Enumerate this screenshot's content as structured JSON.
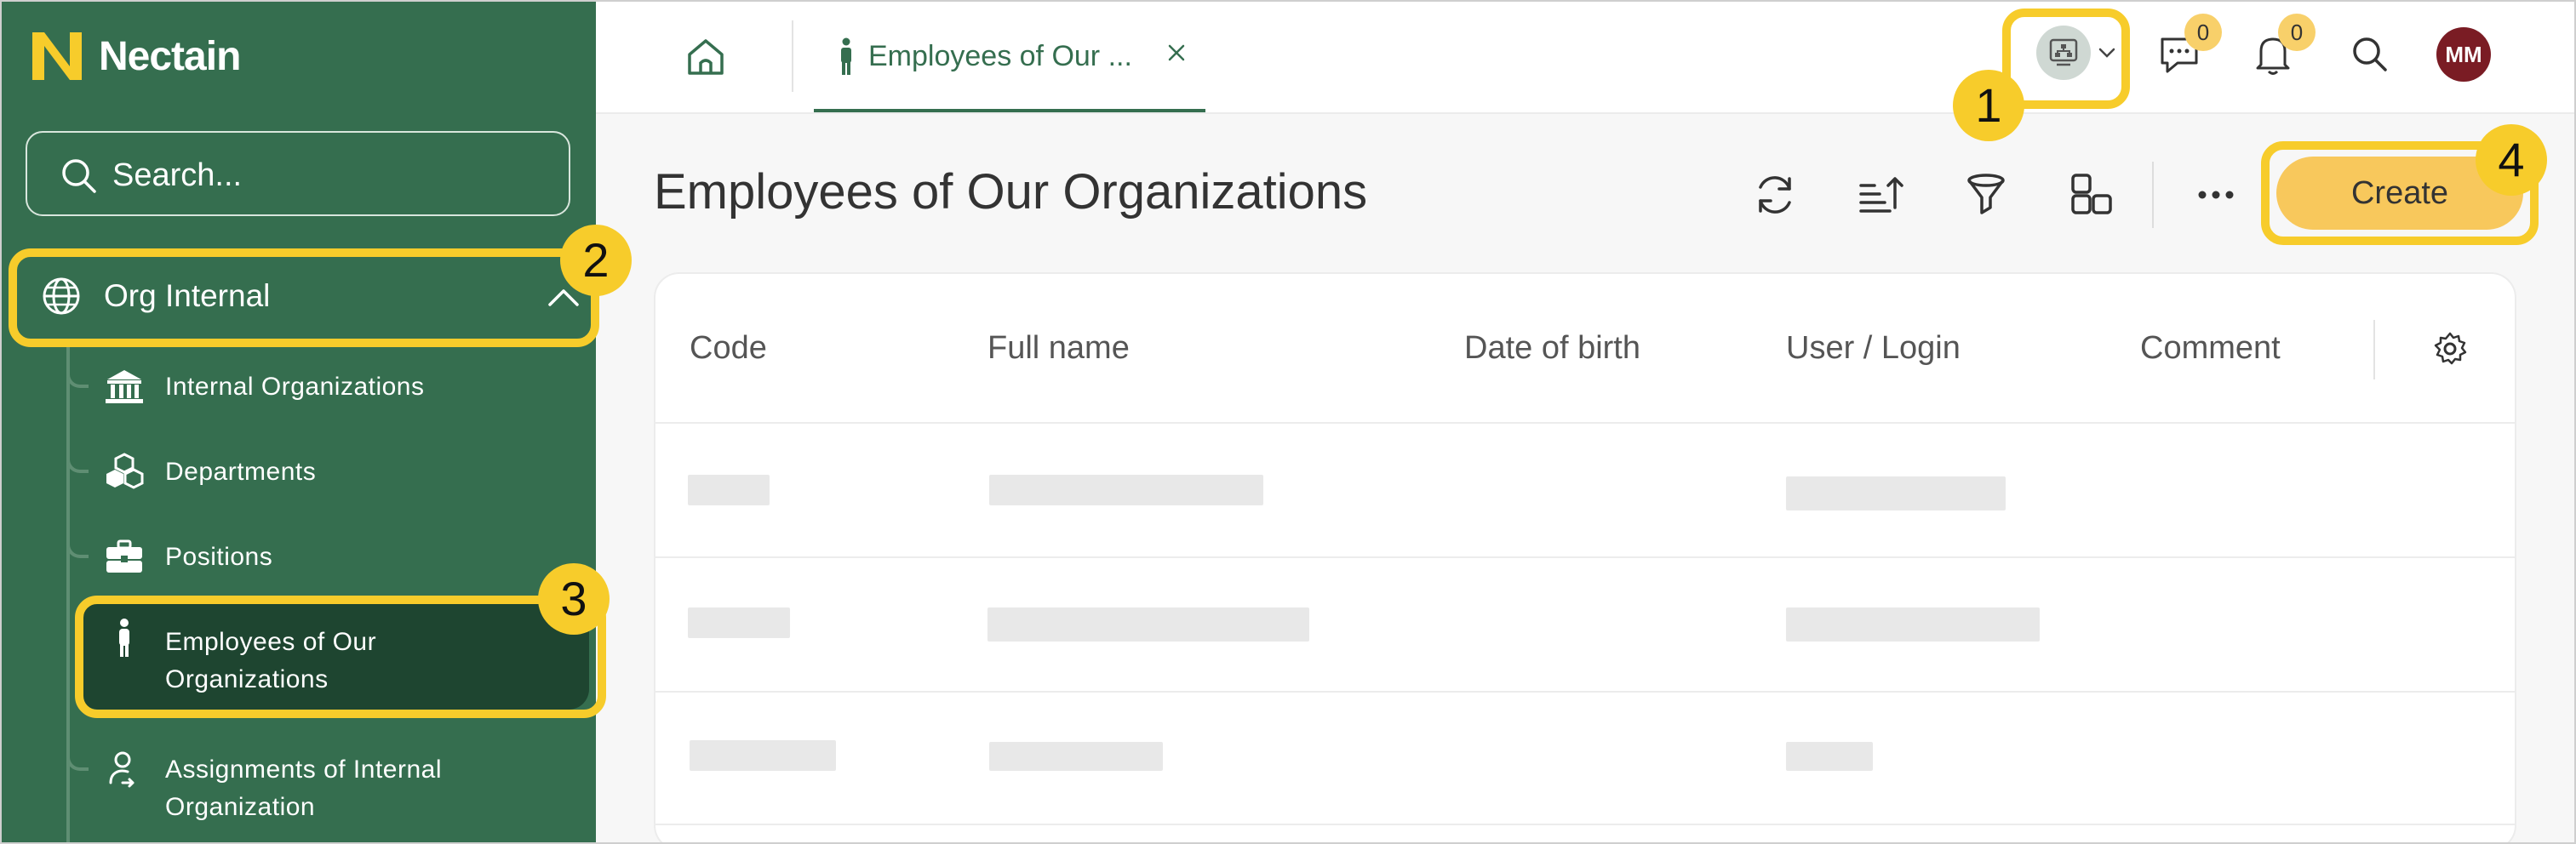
{
  "brand": {
    "name": "Nectain"
  },
  "search": {
    "placeholder": "Search..."
  },
  "sidebar": {
    "group": {
      "label": "Org Internal",
      "icon": "globe-icon"
    },
    "items": [
      {
        "label": "Internal Organizations",
        "icon": "bank-icon"
      },
      {
        "label": "Departments",
        "icon": "cubes-icon"
      },
      {
        "label": "Positions",
        "icon": "briefcase-icon"
      },
      {
        "label_line1": "Employees of Our",
        "label_line2": "Organizations",
        "icon": "person-icon",
        "active": true
      },
      {
        "label_line1": "Assignments of Internal",
        "label_line2": "Organization",
        "icon": "user-assign-icon"
      }
    ]
  },
  "topbar": {
    "tab_label": "Employees of Our ...",
    "messages_count": "0",
    "notifications_count": "0",
    "avatar_initials": "MM"
  },
  "page": {
    "title": "Employees of Our Organizations",
    "create_label": "Create"
  },
  "table": {
    "columns": [
      "Code",
      "Full name",
      "Date of birth",
      "User / Login",
      "Comment"
    ],
    "rows_loading": 3
  },
  "callouts": [
    "1",
    "2",
    "3",
    "4"
  ],
  "colors": {
    "sidebar": "#356e4f",
    "active_item": "#1e4530",
    "accent": "#f8c85c",
    "highlight": "#f7cc2b",
    "avatar": "#7a1c24"
  }
}
